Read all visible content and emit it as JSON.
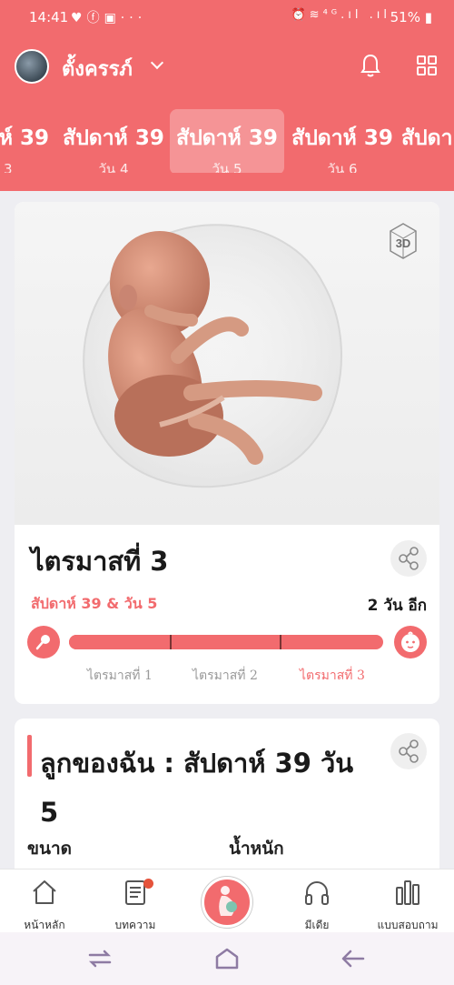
{
  "status_bar": {
    "time": "14:41",
    "left_icons": [
      "heart-icon",
      "messenger-icon",
      "flipboard-icon",
      "more-icon"
    ],
    "right_icons": [
      "alarm-icon",
      "wifi-icon",
      "4g-icon",
      "signal-icon"
    ],
    "battery": "51%"
  },
  "header": {
    "user_name": "ตั้งครรภ์",
    "icons": [
      "bell-icon",
      "grid-icon"
    ]
  },
  "week_tabs": [
    {
      "week": "ห์ 39",
      "day": "วัน 3",
      "active": false
    },
    {
      "week": "สัปดาห์ 39",
      "day": "วัน 4",
      "active": false
    },
    {
      "week": "สัปดาห์ 39",
      "day": "วัน 5",
      "active": true
    },
    {
      "week": "สัปดาห์ 39",
      "day": "วัน 6",
      "active": false
    },
    {
      "week": "สัปดา",
      "day": "",
      "active": false
    }
  ],
  "trimester_card": {
    "badge": "3D",
    "title": "ไตรมาสที่ 3",
    "week_day": "สัปดาห์ 39 & วัน 5",
    "remaining": "2 วัน อีก",
    "progress_fraction": 0.96,
    "trimesters": [
      "ไตรมาสที่ 1",
      "ไตรมาสที่ 2",
      "ไตรมาสที่ 3"
    ],
    "current_trimester": 3
  },
  "baby_card": {
    "title": "ลูกของฉัน : สัปดาห์ 39 วัน 5",
    "size_label": "ขนาด",
    "weight_label": "น้ำหนัก"
  },
  "bottom_nav": [
    {
      "label": "หน้าหลัก",
      "icon": "home-icon"
    },
    {
      "label": "บทความ",
      "icon": "article-icon",
      "has_badge": true
    },
    {
      "label": "",
      "icon": "pregnancy-icon"
    },
    {
      "label": "มีเดีย",
      "icon": "headphones-icon"
    },
    {
      "label": "แบบสอบถาม",
      "icon": "poll-icon"
    }
  ],
  "colors": {
    "brand": "#f26b6e",
    "background": "#eeeef2",
    "muted_text": "#9a9a9a"
  }
}
